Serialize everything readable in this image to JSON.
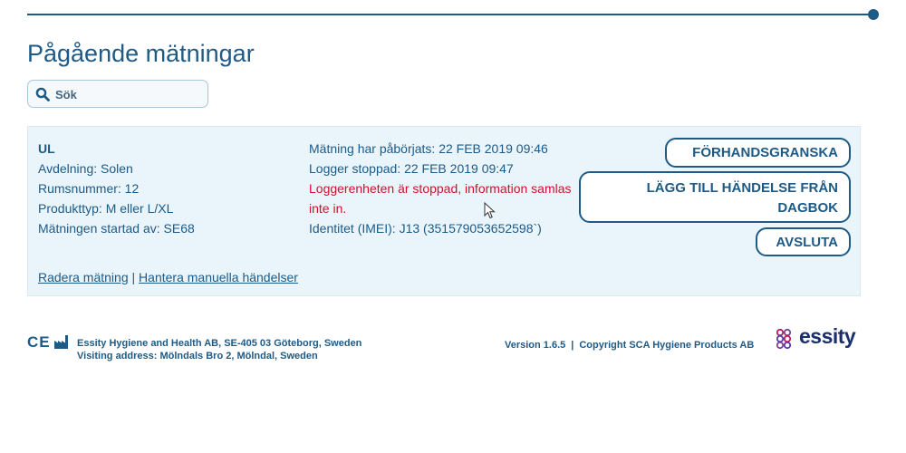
{
  "page": {
    "title": "Pågående mätningar",
    "accent_color": "#1d5a86",
    "warning_color": "#d0112b"
  },
  "search": {
    "placeholder": "Sök",
    "value": "",
    "icon": "search-icon"
  },
  "measurement": {
    "name": "UL",
    "department": "Avdelning: Solen",
    "room": "Rumsnummer: 12",
    "product_type": "Produkttyp: M eller L/XL",
    "started_by": "Mätningen startad av: SE68",
    "started_at": "Mätning har påbörjats: 22 FEB 2019 09:46",
    "logger_stopped": "Logger stoppad: 22 FEB 2019 09:47",
    "warning_line1": "Loggerenheten är stoppad, information samlas",
    "warning_line2": "inte in.",
    "identity": "Identitet (IMEI): J13 (351579053652598`)"
  },
  "actions": {
    "preview": "FÖRHANDSGRANSKA",
    "add_event_line1": "LÄGG TILL HÄNDELSE FRÅN",
    "add_event_line2": "DAGBOK",
    "end": "AVSLUTA"
  },
  "links": {
    "delete": "Radera mätning",
    "separator": "|",
    "manage": "Hantera manuella händelser"
  },
  "footer": {
    "ce_mark": "CE",
    "company_line1": "Essity Hygiene and Health AB, SE-405 03 Göteborg, Sweden",
    "company_line2": "Visiting address: Mölndals Bro 2, Mölndal, Sweden",
    "version": "Version 1.6.5",
    "separator": "|",
    "copyright": "Copyright SCA Hygiene Products AB",
    "brand": "essity"
  }
}
